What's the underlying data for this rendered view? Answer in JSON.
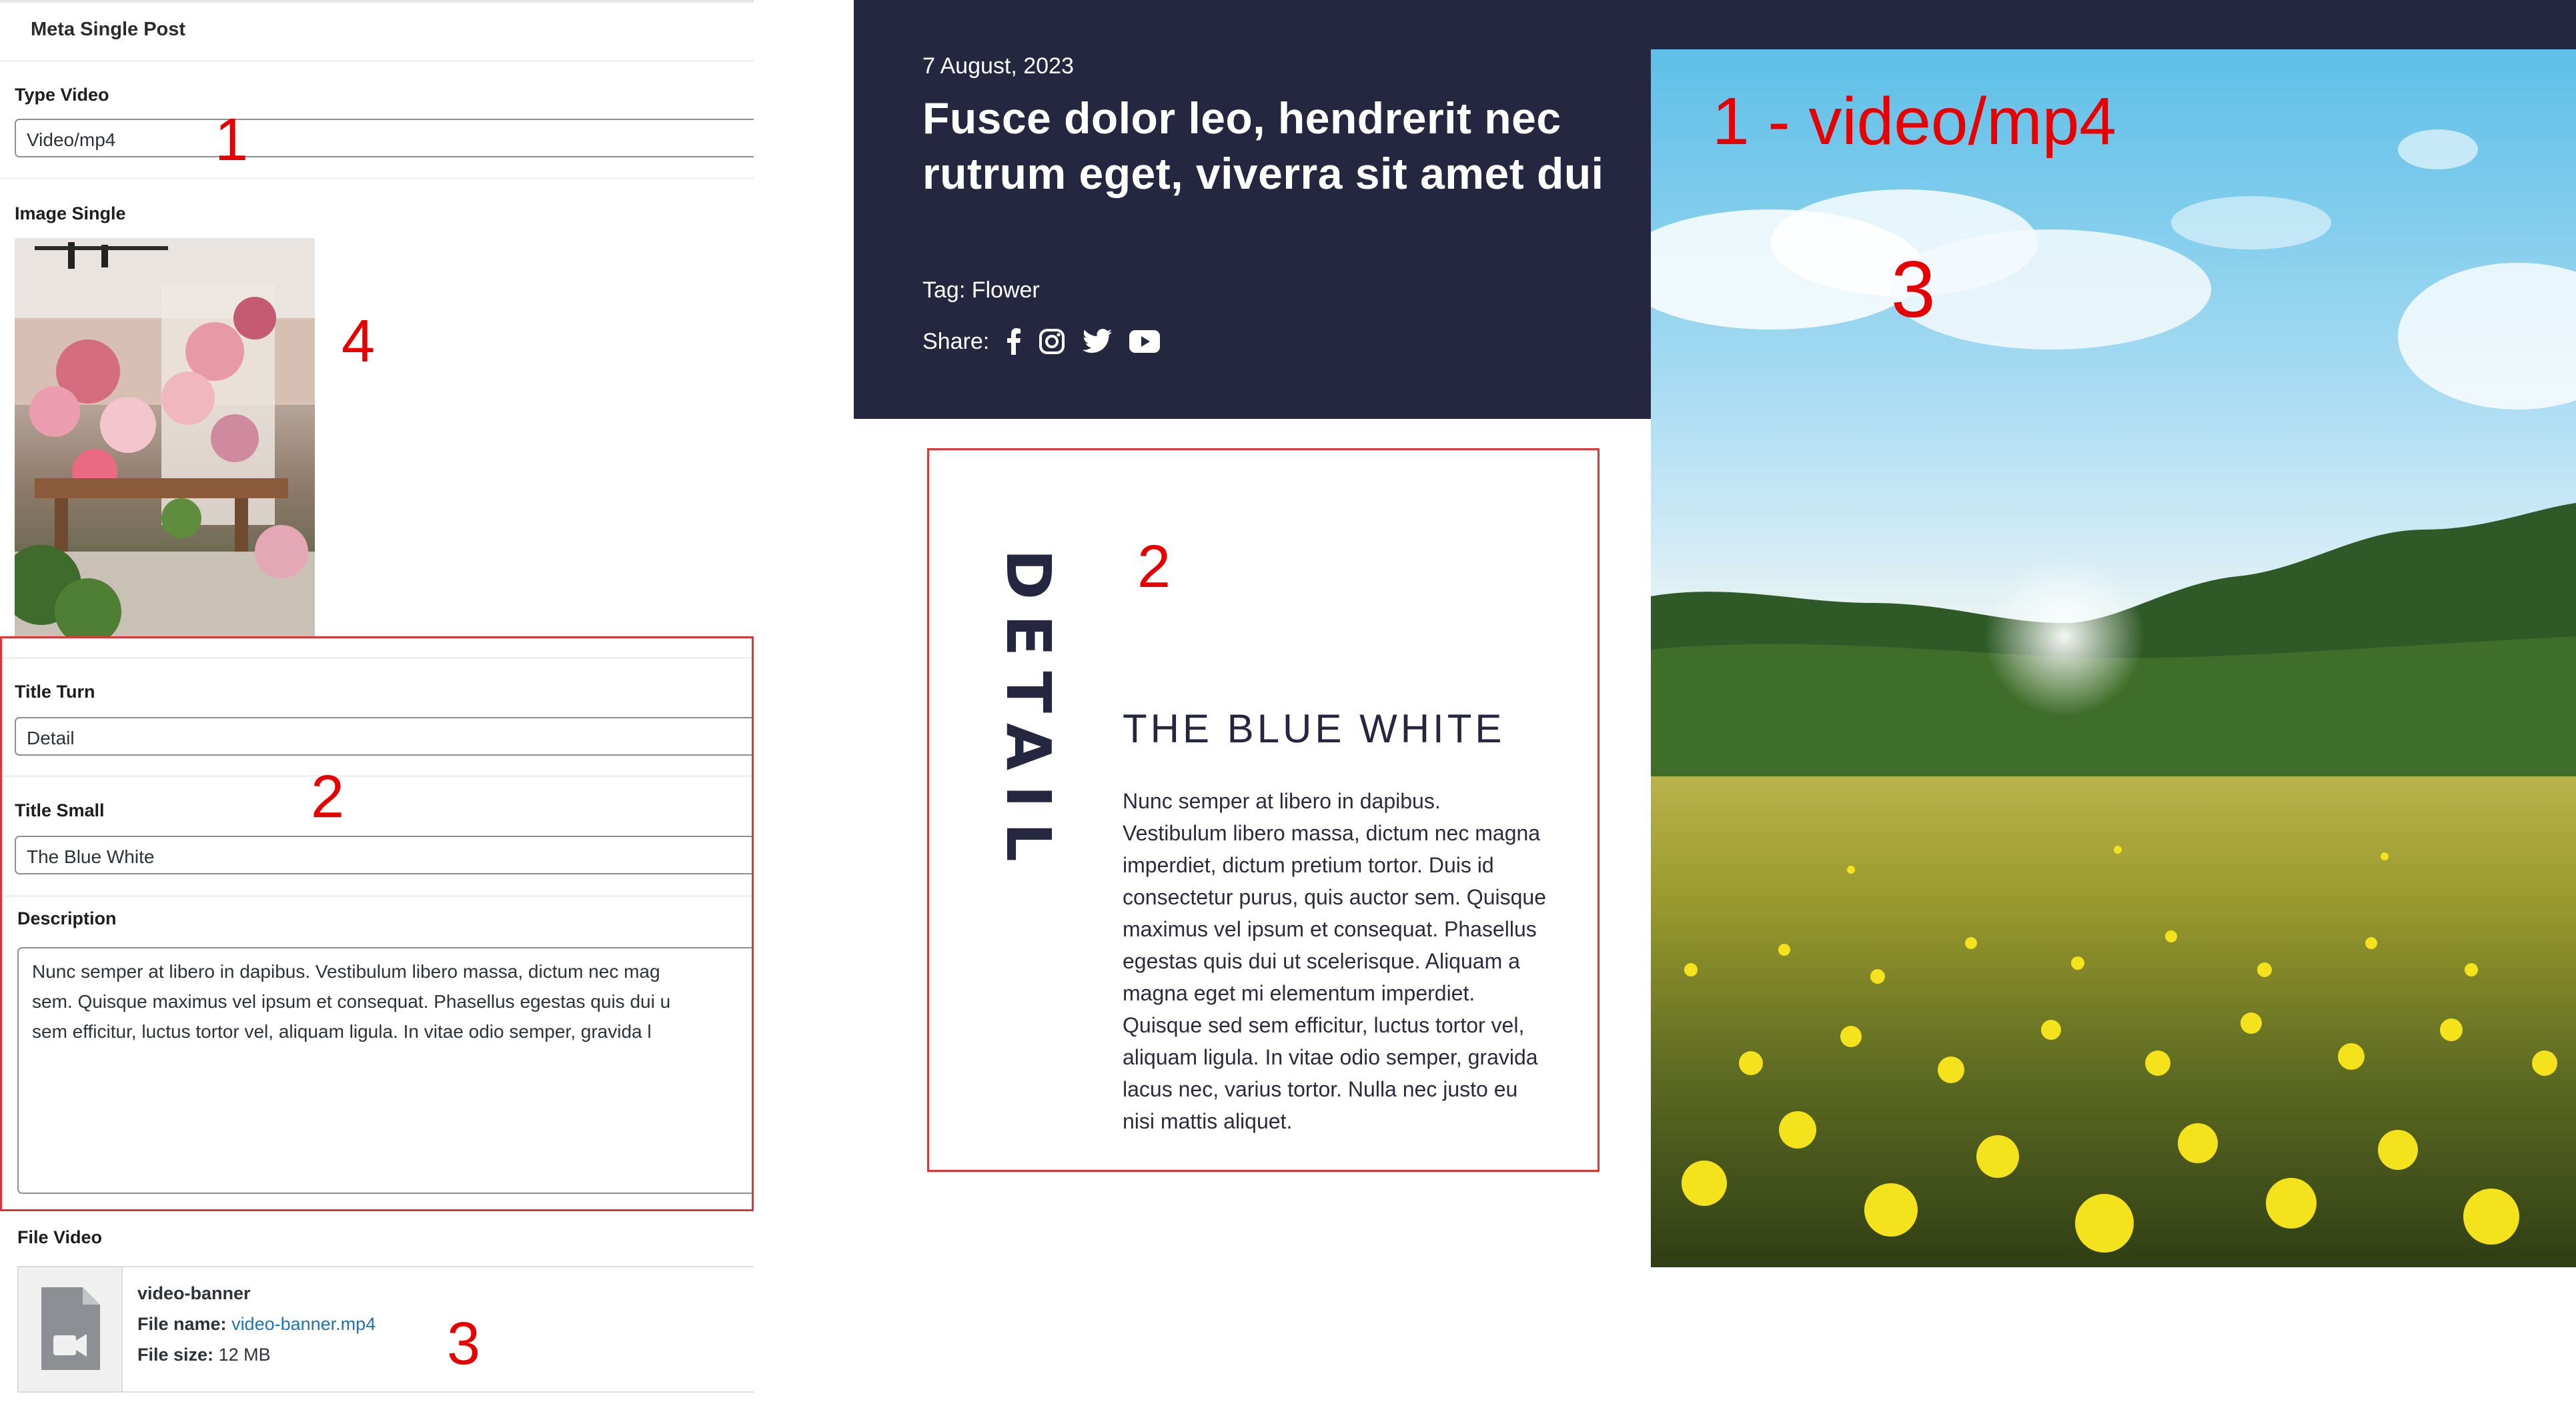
{
  "admin": {
    "panel_title": "Meta Single Post",
    "type_video": {
      "label": "Type Video",
      "value": "Video/mp4"
    },
    "image_single": {
      "label": "Image Single"
    },
    "title_turn": {
      "label": "Title Turn",
      "value": "Detail"
    },
    "title_small": {
      "label": "Title Small",
      "value": "The Blue White"
    },
    "description": {
      "label": "Description",
      "value": "Nunc semper at libero in dapibus. Vestibulum libero massa, dictum nec mag\nsem. Quisque maximus vel ipsum et consequat. Phasellus egestas quis dui u\nsem efficitur, luctus tortor vel, aliquam ligula. In vitae odio semper, gravida l"
    },
    "file_video": {
      "label": "File Video",
      "name": "video-banner",
      "file_name_label": "File name:",
      "file_name": "video-banner.mp4",
      "file_size_label": "File size:",
      "file_size": "12 MB"
    }
  },
  "article": {
    "date": "7 August, 2023",
    "title": "Fusce dolor leo, hendrerit nec rutrum eget, viverra sit amet dui",
    "tag": "Tag: Flower",
    "share_label": "Share:",
    "share_icons": [
      "facebook-icon",
      "instagram-icon",
      "twitter-icon",
      "youtube-icon"
    ],
    "detail": {
      "vertical_title": "DETAIL",
      "small_title": "THE BLUE WHITE",
      "description": "Nunc semper at libero in dapibus.\nVestibulum libero massa, dictum nec magna\nimperdiet, dictum pretium tortor. Duis id\nconsectetur purus, quis auctor sem. Quisque\nmaximus vel ipsum et consequat. Phasellus\negestas quis dui ut scelerisque. Aliquam a\nmagna eget mi elementum imperdiet.\nQuisque sed sem efficitur, luctus tortor vel,\naliquam ligula. In vitae odio semper, gravida\nlacus nec, varius tortor. Nulla nec justo eu\nnisi mattis aliquet."
    }
  },
  "annotations": {
    "n1": "1",
    "n2": "2",
    "n3": "3",
    "n4": "4",
    "video_label": "1 - video/mp4"
  },
  "colors": {
    "dark_navy": "#252741",
    "annotation_red": "#e60000",
    "link_blue": "#2271b1"
  }
}
